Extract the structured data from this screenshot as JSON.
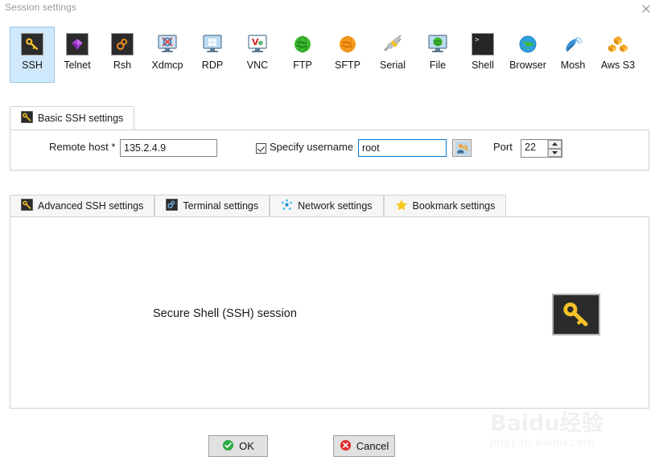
{
  "window": {
    "title": "Session settings",
    "close_icon": "close-icon"
  },
  "protocols": [
    {
      "label": "SSH",
      "icon": "ssh-key-icon",
      "selected": true
    },
    {
      "label": "Telnet",
      "icon": "telnet-gem-icon",
      "selected": false
    },
    {
      "label": "Rsh",
      "icon": "rsh-gears-icon",
      "selected": false
    },
    {
      "label": "Xdmcp",
      "icon": "xdmcp-x-icon",
      "selected": false
    },
    {
      "label": "RDP",
      "icon": "rdp-windows-icon",
      "selected": false
    },
    {
      "label": "VNC",
      "icon": "vnc-icon",
      "selected": false
    },
    {
      "label": "FTP",
      "icon": "ftp-globe-icon",
      "selected": false
    },
    {
      "label": "SFTP",
      "icon": "sftp-globe-icon",
      "selected": false
    },
    {
      "label": "Serial",
      "icon": "serial-plug-icon",
      "selected": false
    },
    {
      "label": "File",
      "icon": "file-monitor-icon",
      "selected": false
    },
    {
      "label": "Shell",
      "icon": "shell-prompt-icon",
      "selected": false
    },
    {
      "label": "Browser",
      "icon": "browser-globe-icon",
      "selected": false
    },
    {
      "label": "Mosh",
      "icon": "mosh-dish-icon",
      "selected": false
    },
    {
      "label": "Aws S3",
      "icon": "aws-s3-icon",
      "selected": false
    }
  ],
  "basic": {
    "tab_label": "Basic SSH settings",
    "tab_icon": "ssh-key-icon",
    "remote_host_label": "Remote host *",
    "remote_host_value": "135.2.4.9",
    "remote_host_placeholder": "",
    "specify_username_label": "Specify username",
    "specify_username_checked": true,
    "username_value": "root",
    "username_placeholder": "",
    "user_button_icon": "user-key-icon",
    "port_label": "Port",
    "port_value": "22",
    "spin_up_icon": "chevron-up-icon",
    "spin_down_icon": "chevron-down-icon"
  },
  "secondary_tabs": [
    {
      "label": "Advanced SSH settings",
      "icon": "ssh-key-icon"
    },
    {
      "label": "Terminal settings",
      "icon": "terminal-icon"
    },
    {
      "label": "Network settings",
      "icon": "network-nodes-icon"
    },
    {
      "label": "Bookmark settings",
      "icon": "star-icon"
    }
  ],
  "content": {
    "session_text": "Secure Shell (SSH) session",
    "big_icon": "ssh-key-icon"
  },
  "buttons": {
    "ok_label": "OK",
    "ok_icon": "check-circle-icon",
    "cancel_label": "Cancel",
    "cancel_icon": "x-circle-icon"
  },
  "watermark": {
    "line1": "Baidu",
    "line2": "jingyan.baidu.com",
    "cjk": "经验"
  },
  "colors": {
    "selected_tab_bg": "#cfe8fb",
    "selected_tab_border": "#9ccaea",
    "focus_border": "#0a7bd4",
    "key_yellow": "#f5c328",
    "ok_green": "#2dab46",
    "cancel_red": "#e02d2d",
    "panel_border": "#d2d2d2",
    "title_gray": "#9a9a9a"
  }
}
